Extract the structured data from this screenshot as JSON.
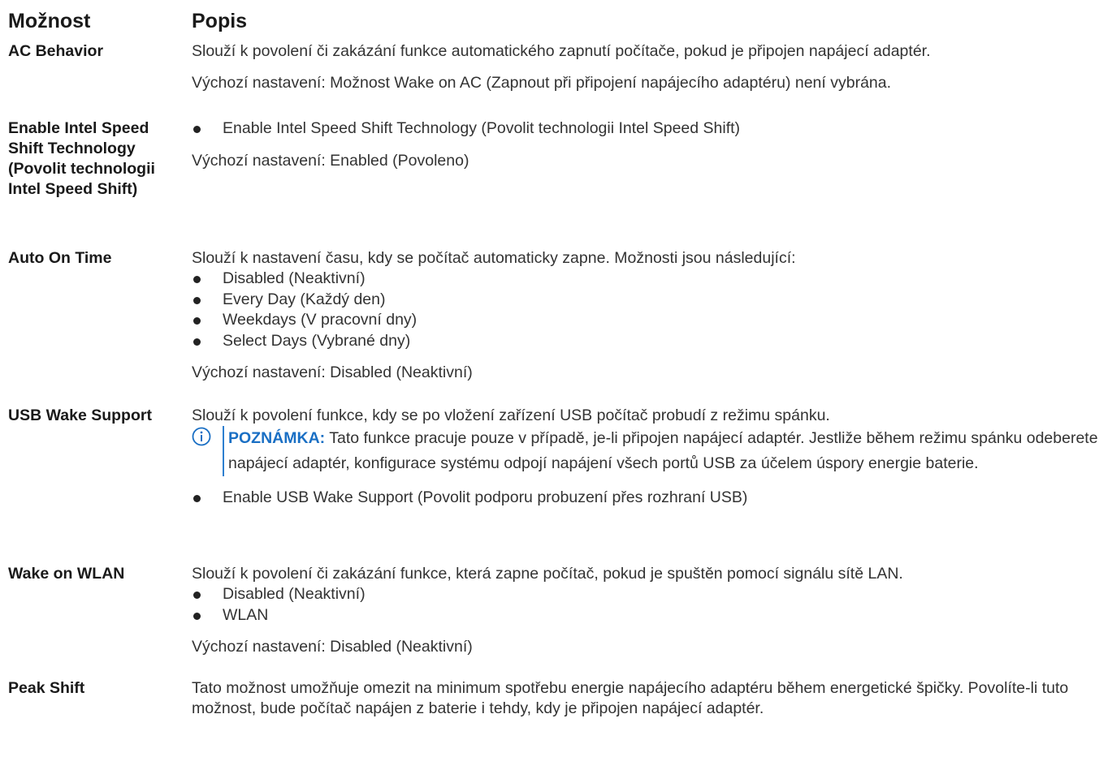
{
  "header": {
    "option_col": "Možnost",
    "desc_col": "Popis"
  },
  "rows": [
    {
      "option": "AC Behavior",
      "desc": "Slouží k povolení či zakázání funkce automatického zapnutí počítače, pokud je připojen napájecí adaptér.",
      "default": "Výchozí nastavení: Možnost Wake on AC (Zapnout při připojení napájecího adaptéru) není vybrána."
    },
    {
      "option": "Enable Intel Speed Shift Technology (Povolit technologii Intel Speed Shift)",
      "bullets": [
        "Enable Intel Speed Shift Technology (Povolit technologii Intel Speed Shift)"
      ],
      "default": "Výchozí nastavení: Enabled (Povoleno)"
    },
    {
      "option": "Auto On Time",
      "desc": "Slouží k nastavení času, kdy se počítač automaticky zapne. Možnosti jsou následující:",
      "bullets": [
        "Disabled (Neaktivní)",
        "Every Day (Každý den)",
        "Weekdays (V pracovní dny)",
        "Select Days (Vybrané dny)"
      ],
      "default": "Výchozí nastavení: Disabled (Neaktivní)"
    },
    {
      "option": "USB Wake Support",
      "desc": "Slouží k povolení funkce, kdy se po vložení zařízení USB počítač probudí z režimu spánku.",
      "note_label": "POZNÁMKA:",
      "note_text": " Tato funkce pracuje pouze v případě, je-li připojen napájecí adaptér. Jestliže během režimu spánku odeberete napájecí adaptér, konfigurace systému odpojí napájení všech portů USB za účelem úspory energie baterie.",
      "bullets": [
        "Enable USB Wake Support (Povolit podporu probuzení přes rozhraní USB)"
      ]
    },
    {
      "option": "Wake on WLAN",
      "desc": "Slouží k povolení či zakázání funkce, která zapne počítač, pokud je spuštěn pomocí signálu sítě LAN.",
      "bullets": [
        "Disabled (Neaktivní)",
        "WLAN"
      ],
      "default": "Výchozí nastavení: Disabled (Neaktivní)"
    },
    {
      "option": "Peak Shift",
      "desc": "Tato možnost umožňuje omezit na minimum spotřebu energie napájecího adaptéru během energetické špičky. Povolíte-li tuto možnost, bude počítač napájen z baterie i tehdy, kdy je připojen napájecí adaptér."
    }
  ],
  "colors": {
    "note_accent": "#1a6fc4",
    "note_bar": "#2e7fd0"
  }
}
